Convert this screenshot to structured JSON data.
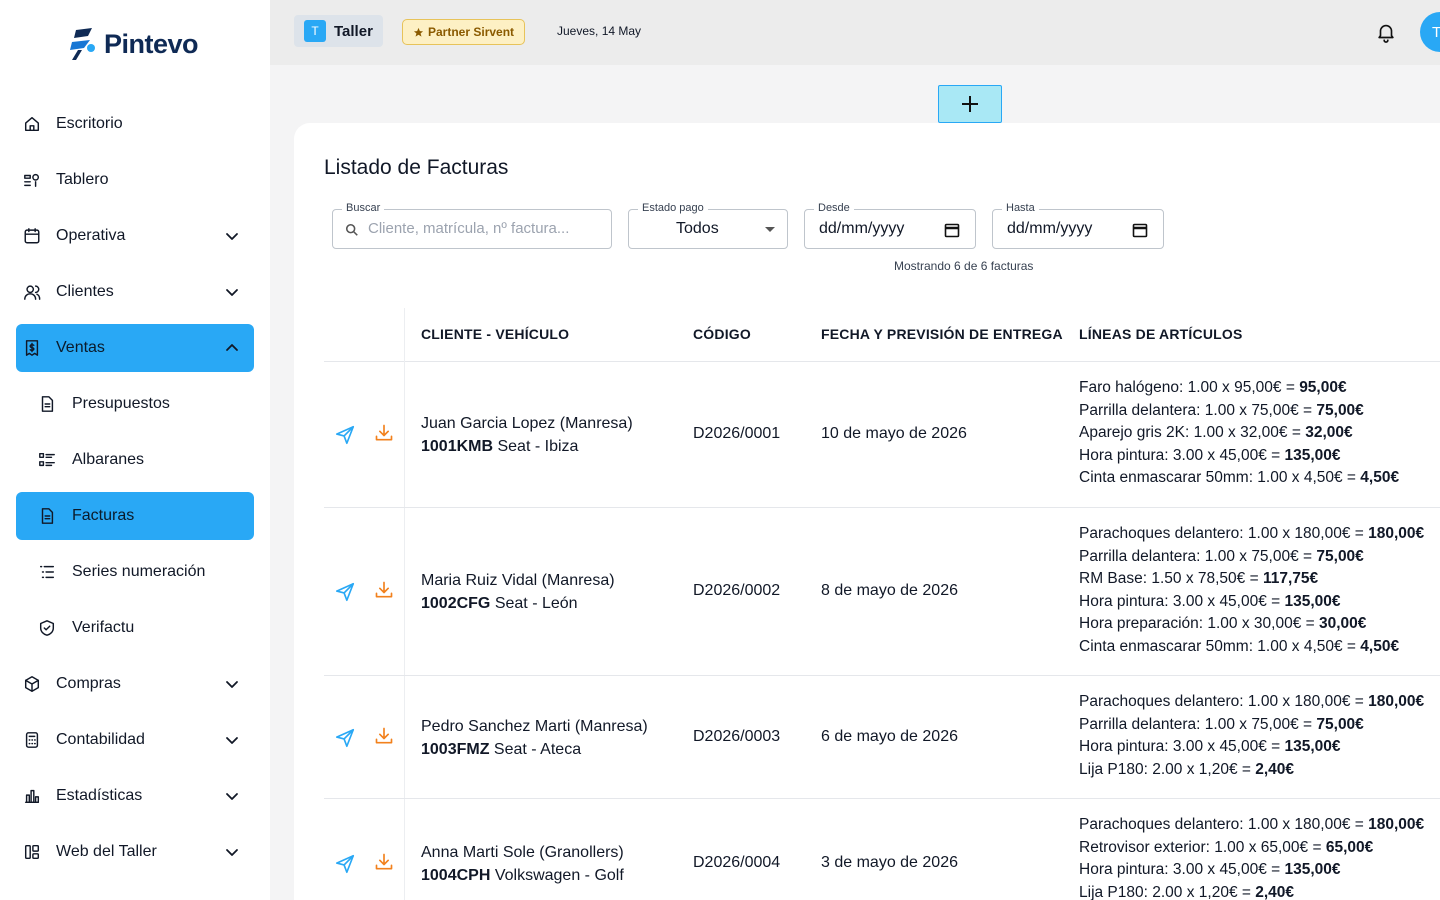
{
  "brand": {
    "name": "Pintevo",
    "accent": "#29a8f5",
    "navy": "#0f2a55"
  },
  "sidebar": {
    "items": [
      {
        "label": "Escritorio",
        "icon": "home-icon",
        "chevron": "",
        "active": false,
        "sub": false
      },
      {
        "label": "Tablero",
        "icon": "board-icon",
        "chevron": "",
        "active": false,
        "sub": false
      },
      {
        "label": "Operativa",
        "icon": "calendar-icon",
        "chevron": "down",
        "active": false,
        "sub": false
      },
      {
        "label": "Clientes",
        "icon": "users-icon",
        "chevron": "down",
        "active": false,
        "sub": false
      },
      {
        "label": "Ventas",
        "icon": "receipt-icon",
        "chevron": "up",
        "active": true,
        "sub": false
      },
      {
        "label": "Presupuestos",
        "icon": "document-icon",
        "chevron": "",
        "active": false,
        "sub": true
      },
      {
        "label": "Albaranes",
        "icon": "list-icon",
        "chevron": "",
        "active": false,
        "sub": true
      },
      {
        "label": "Facturas",
        "icon": "invoice-icon",
        "chevron": "",
        "active": true,
        "sub": true
      },
      {
        "label": "Series numeración",
        "icon": "list-indent-icon",
        "chevron": "",
        "active": false,
        "sub": true
      },
      {
        "label": "Verifactu",
        "icon": "shield-icon",
        "chevron": "",
        "active": false,
        "sub": true
      },
      {
        "label": "Compras",
        "icon": "box-icon",
        "chevron": "down",
        "active": false,
        "sub": false
      },
      {
        "label": "Contabilidad",
        "icon": "calculator-icon",
        "chevron": "down",
        "active": false,
        "sub": false
      },
      {
        "label": "Estadísticas",
        "icon": "bar-chart-icon",
        "chevron": "down",
        "active": false,
        "sub": false
      },
      {
        "label": "Web del Taller",
        "icon": "layout-icon",
        "chevron": "down",
        "active": false,
        "sub": false
      }
    ]
  },
  "topbar": {
    "workshop_initial": "T",
    "workshop_name": "Taller",
    "partner_label": "Partner Sirvent",
    "date": "Jueves, 14 May",
    "avatar_initial": "T"
  },
  "main": {
    "title": "Listado de Facturas",
    "filters": {
      "search_label": "Buscar",
      "search_placeholder": "Cliente, matrícula, nº factura...",
      "estado_label": "Estado pago",
      "estado_value": "Todos",
      "desde_label": "Desde",
      "desde_value": "dd/mm/yyyy",
      "hasta_label": "Hasta",
      "hasta_value": "dd/mm/yyyy"
    },
    "count_text": "Mostrando 6 de 6 facturas",
    "columns": [
      "CLIENTE - VEHÍCULO",
      "CÓDIGO",
      "FECHA Y PREVISIÓN DE ENTREGA",
      "LÍNEAS DE ARTÍCULOS"
    ],
    "rows": [
      {
        "client": "Juan Garcia Lopez (Manresa)",
        "plate": "1001KMB",
        "vehicle": "Seat - Ibiza",
        "code": "D2026/0001",
        "date": "10 de mayo de 2026",
        "lines": [
          {
            "desc": "Faro halógeno: 1.00 x 95,00€ = ",
            "total": "95,00€"
          },
          {
            "desc": "Parrilla delantera: 1.00 x 75,00€ = ",
            "total": "75,00€"
          },
          {
            "desc": "Aparejo gris 2K: 1.00 x 32,00€ = ",
            "total": "32,00€"
          },
          {
            "desc": "Hora pintura: 3.00 x 45,00€ = ",
            "total": "135,00€"
          },
          {
            "desc": "Cinta enmascarar 50mm: 1.00 x 4,50€ = ",
            "total": "4,50€"
          }
        ]
      },
      {
        "client": "Maria Ruiz Vidal (Manresa)",
        "plate": "1002CFG",
        "vehicle": "Seat - León",
        "code": "D2026/0002",
        "date": "8 de mayo de 2026",
        "lines": [
          {
            "desc": "Parachoques delantero: 1.00 x 180,00€ = ",
            "total": "180,00€"
          },
          {
            "desc": "Parrilla delantera: 1.00 x 75,00€ = ",
            "total": "75,00€"
          },
          {
            "desc": "RM Base: 1.50 x 78,50€ = ",
            "total": "117,75€"
          },
          {
            "desc": "Hora pintura: 3.00 x 45,00€ = ",
            "total": "135,00€"
          },
          {
            "desc": "Hora preparación: 1.00 x 30,00€ = ",
            "total": "30,00€"
          },
          {
            "desc": "Cinta enmascarar 50mm: 1.00 x 4,50€ = ",
            "total": "4,50€"
          }
        ]
      },
      {
        "client": "Pedro Sanchez Marti (Manresa)",
        "plate": "1003FMZ",
        "vehicle": "Seat - Ateca",
        "code": "D2026/0003",
        "date": "6 de mayo de 2026",
        "lines": [
          {
            "desc": "Parachoques delantero: 1.00 x 180,00€ = ",
            "total": "180,00€"
          },
          {
            "desc": "Parrilla delantera: 1.00 x 75,00€ = ",
            "total": "75,00€"
          },
          {
            "desc": "Hora pintura: 3.00 x 45,00€ = ",
            "total": "135,00€"
          },
          {
            "desc": "Lija P180: 2.00 x 1,20€ = ",
            "total": "2,40€"
          }
        ]
      },
      {
        "client": "Anna Marti Sole (Granollers)",
        "plate": "1004CPH",
        "vehicle": "Volkswagen - Golf",
        "code": "D2026/0004",
        "date": "3 de mayo de 2026",
        "lines": [
          {
            "desc": "Parachoques delantero: 1.00 x 180,00€ = ",
            "total": "180,00€"
          },
          {
            "desc": "Retrovisor exterior: 1.00 x 65,00€ = ",
            "total": "65,00€"
          },
          {
            "desc": "Hora pintura: 3.00 x 45,00€ = ",
            "total": "135,00€"
          },
          {
            "desc": "Lija P180: 2.00 x 1,20€ = ",
            "total": "2,40€"
          }
        ]
      }
    ]
  }
}
